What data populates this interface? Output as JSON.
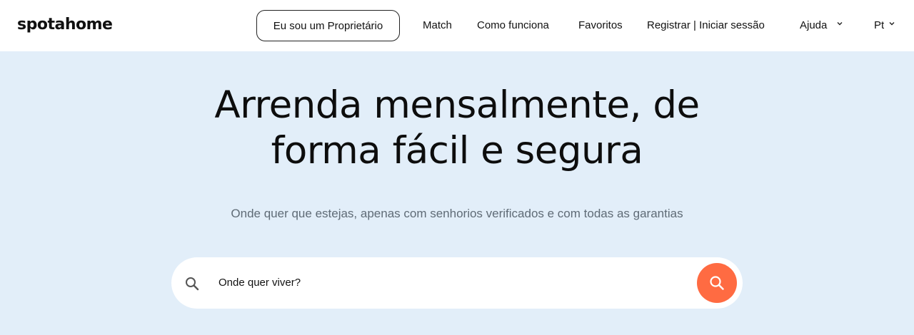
{
  "header": {
    "logo": "spotahome",
    "owner_button": "Eu sou um Proprietário",
    "nav": {
      "match": "Match",
      "how_it_works": "Como funciona",
      "favorites": "Favoritos",
      "register_login": "Registrar | Iniciar sessão",
      "help": "Ajuda",
      "language": "Pt"
    }
  },
  "hero": {
    "title_line1": "Arrenda mensalmente, de",
    "title_line2": "forma fácil e segura",
    "subtitle": "Onde quer que estejas, apenas com senhorios verificados e com todas as garantias"
  },
  "search": {
    "placeholder": "Onde quer viver?",
    "icon": "search-icon",
    "button_icon": "search-icon"
  },
  "colors": {
    "background": "#e2eef9",
    "accent": "#ff6b42",
    "header_bg": "#ffffff"
  }
}
